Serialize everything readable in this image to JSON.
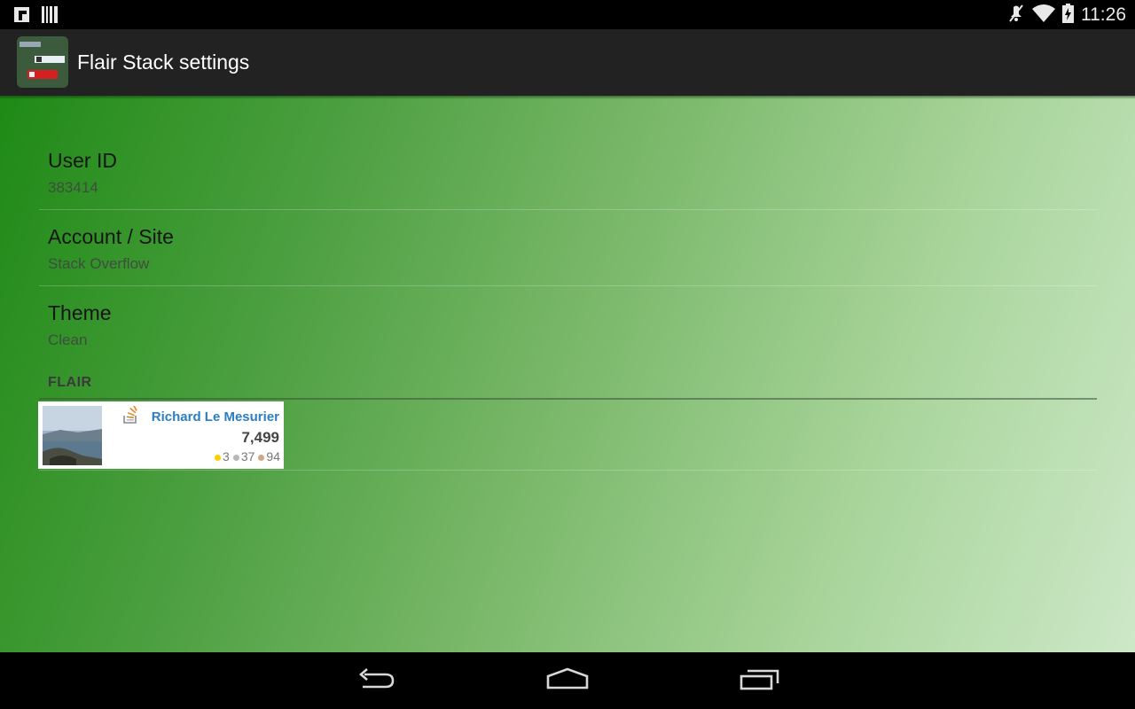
{
  "status_bar": {
    "left_icons": [
      "flipboard-icon",
      "barcode-icon"
    ],
    "right_icons": [
      "mute-icon",
      "wifi-icon",
      "battery-charging-icon"
    ],
    "clock": "11:26"
  },
  "action_bar": {
    "title": "Flair Stack settings",
    "app_icon": "flair-stack-app-icon"
  },
  "preferences": [
    {
      "title": "User ID",
      "summary": "383414"
    },
    {
      "title": "Account / Site",
      "summary": "Stack Overflow"
    },
    {
      "title": "Theme",
      "summary": "Clean"
    }
  ],
  "flair_section": {
    "header": "FLAIR",
    "flair_card": {
      "name": "Richard Le Mesurier",
      "reputation": "7,499",
      "badges": {
        "gold": "3",
        "silver": "37",
        "bronze": "94"
      },
      "badge_colors": {
        "gold": "#ffcc01",
        "silver": "#b4b8bc",
        "bronze": "#d1a684"
      },
      "site_icon": "stackoverflow-icon"
    }
  },
  "nav_bar": {
    "buttons": [
      "back-icon",
      "home-icon",
      "recents-icon"
    ]
  },
  "colors": {
    "action_bar": "#222222",
    "gradient_start": "#1f8a16",
    "gradient_end": "#cde8c8",
    "link_blue": "#2a7ec4"
  }
}
